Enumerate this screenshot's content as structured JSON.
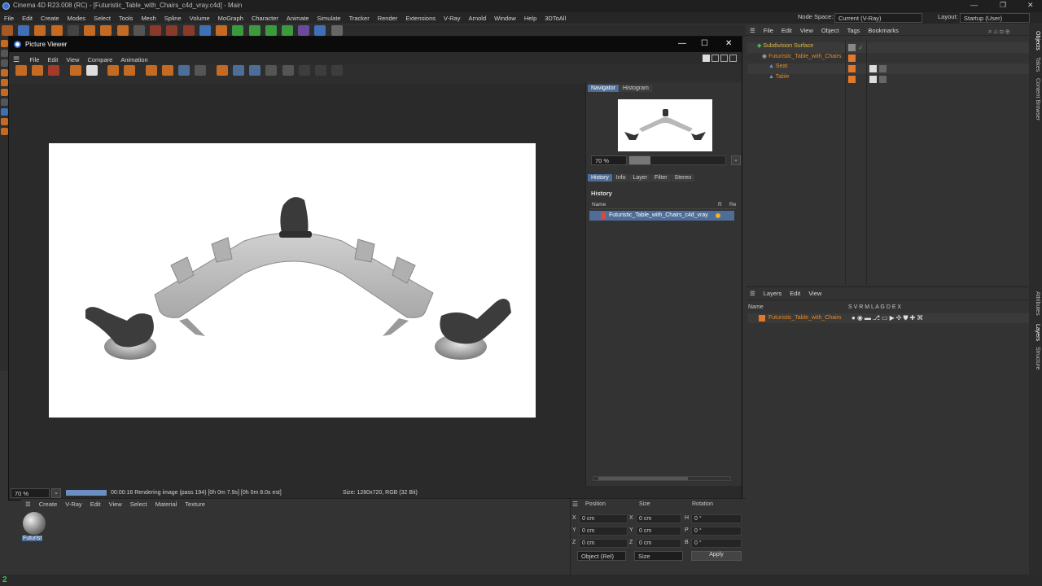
{
  "window": {
    "title": "Cinema 4D R23.008 (RC) - [Futuristic_Table_with_Chairs_c4d_vray.c4d] - Main",
    "controls": [
      "—",
      "❐",
      "✕"
    ]
  },
  "menubar": {
    "items": [
      "File",
      "Edit",
      "Create",
      "Modes",
      "Select",
      "Tools",
      "Mesh",
      "Spline",
      "Volume",
      "MoGraph",
      "Character",
      "Animate",
      "Simulate",
      "Tracker",
      "Render",
      "Extensions",
      "V-Ray",
      "Arnold",
      "Window",
      "Help",
      "3DToAll"
    ],
    "node_space_label": "Node Space:",
    "node_space_value": "Current (V-Ray)",
    "layout_label": "Layout:",
    "layout_value": "Startup (User)"
  },
  "picture_viewer": {
    "title": "Picture Viewer",
    "controls": [
      "—",
      "☐",
      "✕"
    ],
    "menu": [
      "File",
      "Edit",
      "View",
      "Compare",
      "Animation"
    ],
    "zoom": "70 %",
    "status_text": "00:00:16 Rendering image (pass 194) [0h  0m  7.9s] [0h  0m  8.0s est]",
    "size_text": "Size: 1280x720, RGB (32 Bit)",
    "progress": 1.0,
    "side_tabs_top": [
      "Navigator",
      "Histogram"
    ],
    "nav_zoom": "70 %",
    "side_tabs_bottom": [
      "History",
      "Info",
      "Layer",
      "Filter",
      "Stereo"
    ],
    "history_heading": "History",
    "history_columns": [
      "Name",
      "R",
      "Re"
    ],
    "history_item": "Futuristic_Table_with_Chairs_c4d_vray"
  },
  "object_manager": {
    "menu": [
      "File",
      "Edit",
      "View",
      "Object",
      "Tags",
      "Bookmarks"
    ],
    "objects": [
      {
        "name": "Subdivision Surface",
        "color": "#e0b83a"
      },
      {
        "name": "Futuristic_Table_with_Chairs",
        "color": "#e28a2a"
      },
      {
        "name": "Seat",
        "color": "#e28a2a"
      },
      {
        "name": "Table",
        "color": "#e28a2a"
      }
    ]
  },
  "layer_manager": {
    "menu": [
      "Layers",
      "Edit",
      "View"
    ],
    "name_header": "Name",
    "flags": "S V R M L A G D E X",
    "layer_name": "Futuristic_Table_with_Chairs"
  },
  "vertical_tabs": [
    "Objects",
    "Takes",
    "Content Browser",
    "Attributes",
    "Layers",
    "Structure"
  ],
  "material_manager": {
    "menu": [
      "Create",
      "V-Ray",
      "Edit",
      "View",
      "Select",
      "Material",
      "Texture"
    ],
    "material_label": "Futurist"
  },
  "coordinates": {
    "headers": [
      "Position",
      "Size",
      "Rotation"
    ],
    "rows": [
      {
        "axis": "X",
        "pos": "0 cm",
        "size_axis": "X",
        "size": "0 cm",
        "rot_axis": "H",
        "rot": "0 °"
      },
      {
        "axis": "Y",
        "pos": "0 cm",
        "size_axis": "Y",
        "size": "0 cm",
        "rot_axis": "P",
        "rot": "0 °"
      },
      {
        "axis": "Z",
        "pos": "0 cm",
        "size_axis": "Z",
        "size": "0 cm",
        "rot_axis": "B",
        "rot": "0 °"
      }
    ],
    "mode": "Object (Rel)",
    "size_mode": "Size",
    "apply": "Apply"
  }
}
